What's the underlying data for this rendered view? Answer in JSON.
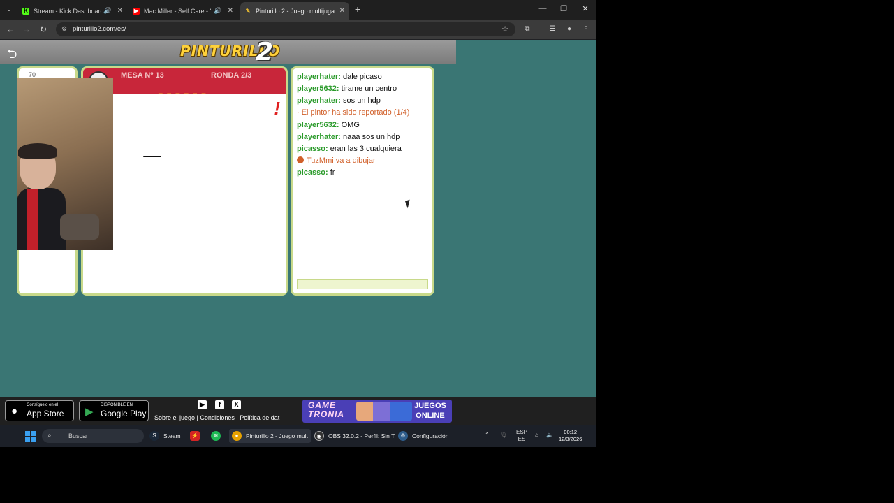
{
  "browser": {
    "tabs": [
      {
        "title": "Stream - Kick Dashboard",
        "active": false
      },
      {
        "title": "Mac Miller - Self Care - You",
        "active": false
      },
      {
        "title": "Pinturillo 2 - Juego multijugad",
        "active": true
      }
    ],
    "url": "pinturillo2.com/es/"
  },
  "game": {
    "logo_text": "PINTURILLO",
    "logo_number": "2",
    "score": "70",
    "mesa": "MESA Nº 13",
    "ronda": "RONDA 2/3",
    "word_hint": "_ _ _ _ _ _"
  },
  "chat": {
    "messages": [
      {
        "user": "playerhater:",
        "text": "dale picaso"
      },
      {
        "user": "player5632:",
        "text": "tirame un centro"
      },
      {
        "user": "playerhater:",
        "text": "sos un hdp"
      },
      {
        "system": "· El pintor ha sido reportado (1/4)"
      },
      {
        "user": "player5632:",
        "text": "OMG"
      },
      {
        "user": "playerhater:",
        "text": "naaa sos un hdp"
      },
      {
        "user": "picasso:",
        "text": "eran las 3 cualquiera"
      },
      {
        "turn": "TuzMmi va a dibujar"
      },
      {
        "user": "picasso:",
        "text": "fr"
      }
    ]
  },
  "footer": {
    "appstore_small": "Consíguelo en el",
    "appstore_big": "App Store",
    "googleplay_small": "DISPONIBLE EN",
    "googleplay_big": "Google Play",
    "links": "Sobre el juego | Condiciones | Política de dat",
    "banner_title_1": "GAME",
    "banner_title_2": "TRONIA",
    "banner_right_1": "JUEGOS",
    "banner_right_2": "ONLINE"
  },
  "taskbar": {
    "search": "Buscar",
    "apps": [
      {
        "label": "Steam"
      },
      {
        "label": "Pinturillo 2 - Juego mult"
      },
      {
        "label": "OBS 32.0.2 - Perfil: Sin T"
      },
      {
        "label": "Configuración"
      }
    ],
    "lang_1": "ESP",
    "lang_2": "ES",
    "time": "00:12",
    "date": "12/3/2026"
  },
  "colors": {
    "page_bg": "#3a7674",
    "board_header": "#c8263a",
    "chat_user": "#2a9a2a",
    "chat_system": "#d1602a"
  }
}
